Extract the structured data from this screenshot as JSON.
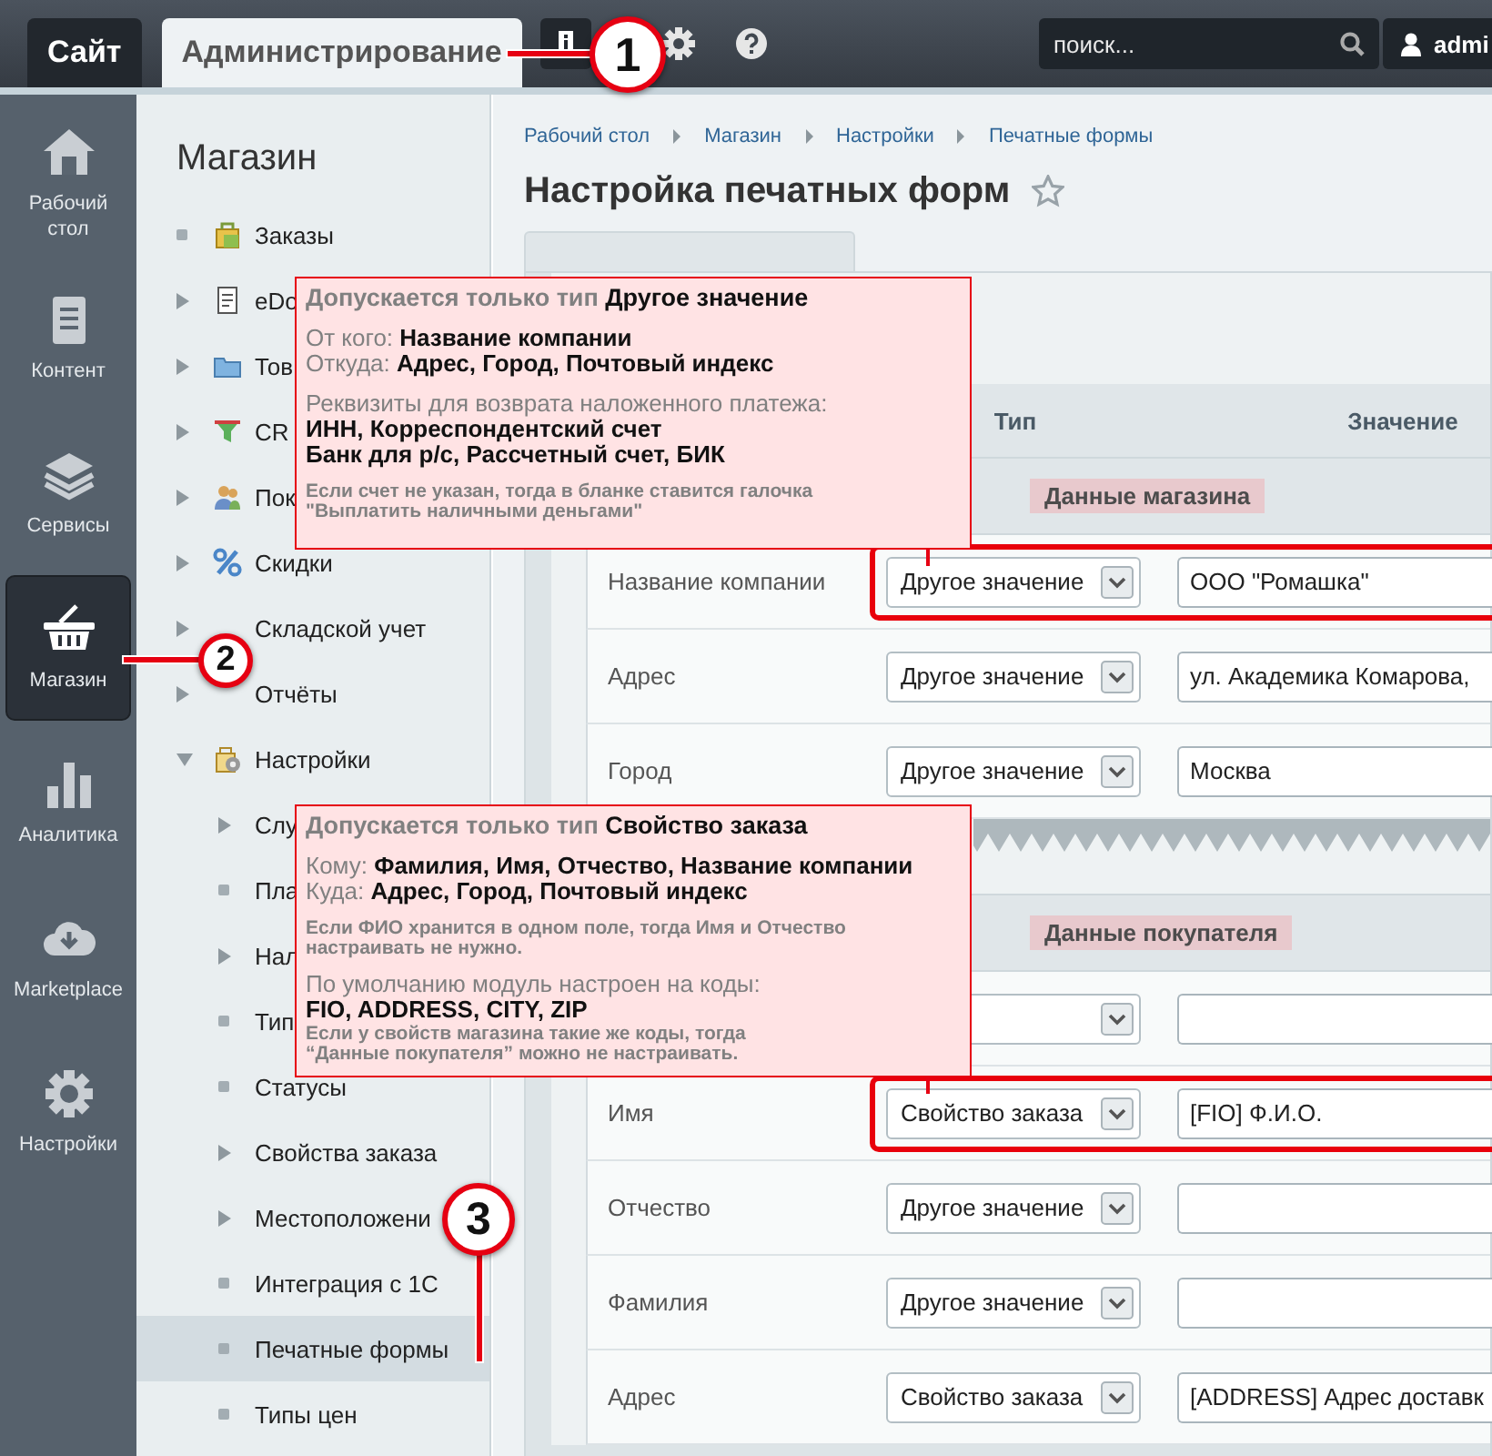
{
  "top_bar": {
    "tabs": [
      {
        "label": "Сайт",
        "selected": false
      },
      {
        "label": "Администрирование",
        "selected": true
      }
    ],
    "search": {
      "placeholder": "поиск..."
    },
    "user": {
      "name": "admi"
    }
  },
  "nav": {
    "items": [
      {
        "label": "Рабочий стол",
        "selected": false
      },
      {
        "label": "Контент",
        "selected": false
      },
      {
        "label": "Сервисы",
        "selected": false
      },
      {
        "label": "Магазин",
        "selected": true
      },
      {
        "label": "Аналитика",
        "selected": false
      },
      {
        "label": "Marketplace",
        "selected": false
      },
      {
        "label": "Настройки",
        "selected": false
      }
    ]
  },
  "sidebar": {
    "title": "Магазин",
    "items": [
      {
        "label": "Заказы",
        "kind": "leaf",
        "selected": false
      },
      {
        "label": "eDo",
        "kind": "node",
        "expanded": false,
        "selected": false
      },
      {
        "label": "Тов",
        "kind": "node",
        "expanded": false,
        "selected": false
      },
      {
        "label": "CR",
        "kind": "node",
        "expanded": false,
        "selected": false
      },
      {
        "label": "Пок",
        "kind": "node",
        "expanded": false,
        "selected": false
      },
      {
        "label": "Скидки",
        "kind": "node",
        "expanded": false,
        "selected": false
      },
      {
        "label": "Складской учет",
        "kind": "node",
        "expanded": false,
        "selected": false
      },
      {
        "label": "Отчёты",
        "kind": "node",
        "expanded": false,
        "selected": false
      },
      {
        "label": "Настройки",
        "kind": "node",
        "expanded": true,
        "selected": false,
        "children": [
          {
            "label": "Слу",
            "kind": "node",
            "expanded": false,
            "selected": false
          },
          {
            "label": "Пла",
            "kind": "leaf",
            "selected": false
          },
          {
            "label": "Нал",
            "kind": "node",
            "expanded": false,
            "selected": false
          },
          {
            "label": "Тип",
            "kind": "leaf",
            "selected": false
          },
          {
            "label": "Статусы",
            "kind": "leaf",
            "selected": false
          },
          {
            "label": "Свойства заказа",
            "kind": "node",
            "expanded": false,
            "selected": false
          },
          {
            "label": "Местоположени",
            "kind": "node",
            "expanded": false,
            "selected": false
          },
          {
            "label": "Интеграция с 1С",
            "kind": "leaf",
            "selected": false
          },
          {
            "label": "Печатные формы",
            "kind": "leaf",
            "selected": true
          },
          {
            "label": "Типы цен",
            "kind": "leaf",
            "selected": false
          }
        ]
      }
    ]
  },
  "breadcrumbs": [
    "Рабочий стол",
    "Магазин",
    "Настройки",
    "Печатные формы"
  ],
  "page_title": "Настройка печатных форм",
  "starred": false,
  "table": {
    "columns": [
      "Тип",
      "Значение"
    ],
    "sections": [
      {
        "title": "Данные магазина",
        "rows": [
          {
            "label": "Название компании",
            "type": "Другое значение",
            "value": "ООО \"Ромашка\"",
            "highlighted": true
          },
          {
            "label": "Адрес",
            "type": "Другое значение",
            "value": "ул. Академика Комарова,",
            "highlighted": false
          },
          {
            "label": "Город",
            "type": "Другое значение",
            "value": "Москва",
            "highlighted": false
          }
        ]
      },
      {
        "title": "Данные покупателя",
        "rows": [
          {
            "highlighted": false
          },
          {
            "label": "Имя",
            "type": "Свойство заказа",
            "value": "[FIO] Ф.И.О.",
            "highlighted": true
          },
          {
            "label": "Отчество",
            "type": "Другое значение",
            "highlighted": false
          },
          {
            "label": "Фамилия",
            "type": "Другое значение",
            "highlighted": false
          },
          {
            "label": "Адрес",
            "type": "Свойство заказа",
            "value": "[ADDRESS] Адрес доставк",
            "highlighted": false
          }
        ]
      }
    ]
  },
  "notes": [
    {
      "title": "Допускается только тип **Другое значение**",
      "blocks": [
        {
          "kind": "main",
          "lines": [
            "От кого: **Название компании**",
            "Откуда: **Адрес, Город, Почтовый индекс**"
          ]
        },
        {
          "kind": "main",
          "lines": [
            "Реквизиты для возврата наложенного платежа:",
            "**ИНН, Корреспондентский счет**",
            "**Банк для р/с, Рассчетный счет, БИК**"
          ]
        },
        {
          "kind": "note",
          "lines": [
            "Если счет не указан, тогда в бланке ставится галочка",
            "\"Выплатить наличными деньгами\""
          ]
        }
      ]
    },
    {
      "title": "Допускается только тип **Свойство заказа**",
      "blocks": [
        {
          "kind": "main",
          "lines": [
            "Кому: **Фамилия, Имя, Отчество, Название компании**",
            "Куда: **Адрес, Город, Почтовый индекс**"
          ]
        },
        {
          "kind": "note",
          "lines": [
            "Если ФИО хранится в одном поле, тогда Имя и Отчество",
            "настраивать не нужно."
          ]
        },
        {
          "kind": "main",
          "lines": [
            "По умолчанию модуль настроен на коды:",
            "**FIO, ADDRESS, CITY, ZIP**"
          ]
        },
        {
          "kind": "subnote",
          "lines": [
            "Если у свойств магазина такие же коды, тогда",
            "“Данные покупателя” можно не настраивать."
          ]
        }
      ]
    }
  ],
  "callouts": [
    {
      "number": "1"
    },
    {
      "number": "2"
    },
    {
      "number": "3"
    }
  ]
}
